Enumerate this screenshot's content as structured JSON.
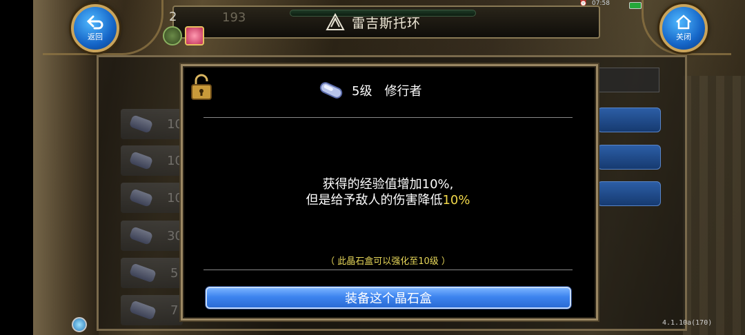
{
  "status_bar": {
    "time": "07:58"
  },
  "top": {
    "title": "雷吉斯托环",
    "level_partial": "2",
    "number": "193",
    "back_label": "返回",
    "close_label": "关闭"
  },
  "list": {
    "rows": [
      {
        "value": "10"
      },
      {
        "value": "10"
      },
      {
        "value": "10"
      },
      {
        "value": "30"
      },
      {
        "value": "5"
      },
      {
        "value": "7"
      }
    ]
  },
  "modal": {
    "level": "5级",
    "name": "修行者",
    "desc_line1": "获得的经验值增加10%,",
    "desc_line2_prefix": "但是给予敌人的伤害降低",
    "desc_line2_value": "10%",
    "note": "（ 此晶石盒可以强化至10级 ）",
    "equip_button": "装备这个晶石盒"
  },
  "footer": {
    "version": "4.1.10a(170)"
  },
  "colors": {
    "highlight": "#f1d84a",
    "note": "#e8d85a",
    "button": "#3d84ef",
    "frame": "#9b8763"
  }
}
